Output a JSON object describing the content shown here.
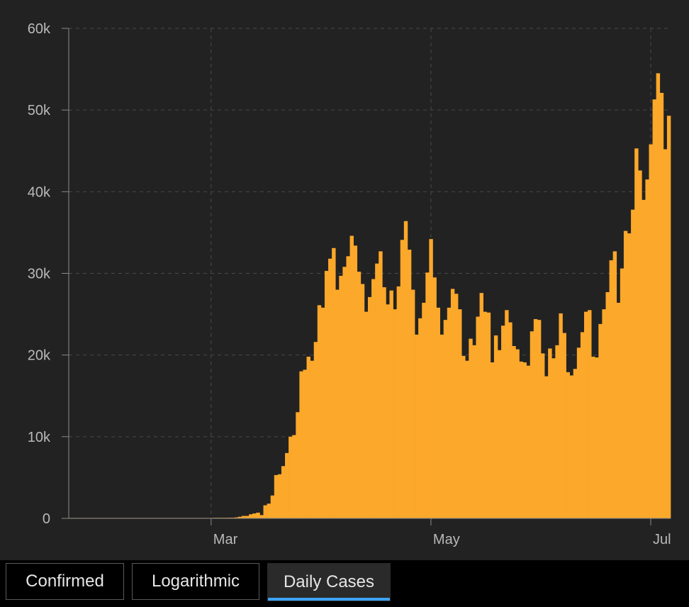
{
  "chart_data": {
    "type": "bar",
    "y_ticks": [
      {
        "value": 0,
        "label": "0"
      },
      {
        "value": 10000,
        "label": "10k"
      },
      {
        "value": 20000,
        "label": "20k"
      },
      {
        "value": 30000,
        "label": "30k"
      },
      {
        "value": 40000,
        "label": "40k"
      },
      {
        "value": 50000,
        "label": "50k"
      },
      {
        "value": 60000,
        "label": "60k"
      }
    ],
    "x_ticks": [
      {
        "index": 39,
        "label": "Mar"
      },
      {
        "index": 100,
        "label": "May"
      },
      {
        "index": 161,
        "label": "Jul"
      }
    ],
    "ylim": [
      0,
      60000
    ],
    "grid": true,
    "bar_color": "#fca82a",
    "values": [
      0,
      0,
      0,
      0,
      0,
      0,
      0,
      0,
      0,
      0,
      0,
      0,
      0,
      0,
      0,
      0,
      0,
      0,
      0,
      0,
      0,
      0,
      0,
      0,
      0,
      0,
      0,
      0,
      0,
      0,
      0,
      0,
      0,
      0,
      0,
      0,
      0,
      0,
      0,
      0,
      10,
      10,
      20,
      60,
      80,
      80,
      120,
      200,
      300,
      300,
      500,
      600,
      700,
      400,
      1600,
      1800,
      2800,
      5300,
      5400,
      6400,
      8000,
      10000,
      10200,
      13000,
      18000,
      18200,
      19800,
      19300,
      21600,
      26100,
      25800,
      30300,
      31800,
      33100,
      28000,
      29700,
      30800,
      32100,
      34600,
      33400,
      30200,
      28700,
      25300,
      27100,
      29300,
      31200,
      32700,
      28300,
      26200,
      27900,
      25600,
      28400,
      34100,
      36400,
      32900,
      28000,
      22500,
      24500,
      26400,
      30100,
      34200,
      29500,
      25800,
      22500,
      24300,
      25800,
      28100,
      27500,
      25600,
      19900,
      19300,
      22000,
      21200,
      24700,
      27600,
      25300,
      25200,
      19100,
      22400,
      20600,
      23600,
      25500,
      24000,
      21100,
      20700,
      19200,
      19100,
      18700,
      22900,
      24400,
      24300,
      20200,
      17400,
      20800,
      19600,
      21200,
      25100,
      22700,
      17900,
      17500,
      18300,
      20900,
      22800,
      25300,
      25500,
      19800,
      19700,
      23800,
      25600,
      27700,
      31600,
      32700,
      26400,
      30600,
      35200,
      34900,
      37800,
      45300,
      42600,
      39000,
      41500,
      45800,
      51300,
      54500,
      52100,
      45200,
      49300
    ]
  },
  "tabs": [
    {
      "label": "Confirmed",
      "active": false
    },
    {
      "label": "Logarithmic",
      "active": false
    },
    {
      "label": "Daily Cases",
      "active": true
    }
  ],
  "colors": {
    "background": "#222222",
    "grid": "#4a4a4a",
    "axis": "#8a8a8a",
    "tab_active_underline": "#3ea2ff"
  }
}
